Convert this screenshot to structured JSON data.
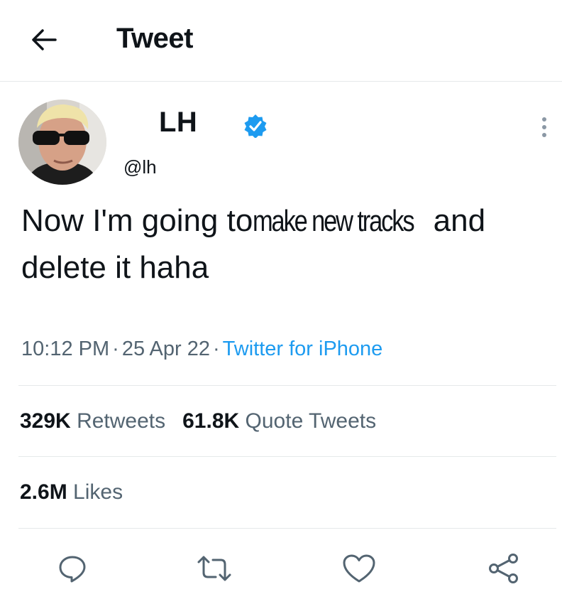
{
  "header": {
    "title": "Tweet",
    "back_icon": "arrow-left-icon"
  },
  "author": {
    "display_name": "LH",
    "handle": "@lh",
    "verified": true,
    "verified_color": "#1d9bf0",
    "avatar": "user-avatar"
  },
  "tweet": {
    "text_part1": "Now I'm going to",
    "text_part2": "make new tracks",
    "text_part3": " and delete it haha",
    "time": "10:12 PM",
    "date": "25 Apr 22",
    "source": "Twitter for iPhone",
    "separator": "·"
  },
  "stats": {
    "retweets_count": "329K",
    "retweets_label": "Retweets",
    "quotes_count": "61.8K",
    "quotes_label": "Quote Tweets",
    "likes_count": "2.6M",
    "likes_label": "Likes"
  },
  "actions": [
    "reply-icon",
    "retweet-icon",
    "like-icon",
    "share-icon"
  ],
  "colors": {
    "text": "#0f1419",
    "secondary": "#536471",
    "link": "#1d9bf0",
    "divider": "#e6e9ea",
    "icon": "#536471"
  }
}
